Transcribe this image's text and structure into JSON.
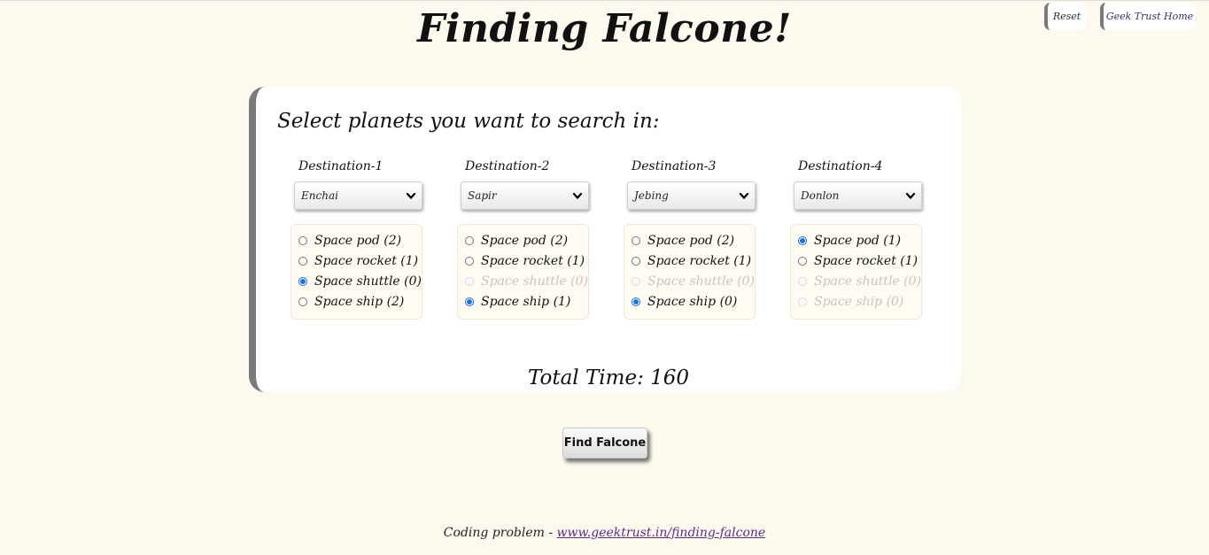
{
  "header": {
    "title": "Finding Falcone!",
    "reset_label": "Reset",
    "home_label": "Geek Trust Home"
  },
  "card": {
    "heading": "Select planets you want to search in:",
    "total_time_label": "Total Time:",
    "total_time_value": "160"
  },
  "destinations": [
    {
      "label": "Destination-1",
      "planet": "Enchai",
      "vehicles": [
        {
          "label": "Space pod (2)",
          "checked": false,
          "disabled": false
        },
        {
          "label": "Space rocket (1)",
          "checked": false,
          "disabled": false
        },
        {
          "label": "Space shuttle (0)",
          "checked": true,
          "disabled": false
        },
        {
          "label": "Space ship (2)",
          "checked": false,
          "disabled": false
        }
      ]
    },
    {
      "label": "Destination-2",
      "planet": "Sapir",
      "vehicles": [
        {
          "label": "Space pod (2)",
          "checked": false,
          "disabled": false
        },
        {
          "label": "Space rocket (1)",
          "checked": false,
          "disabled": false
        },
        {
          "label": "Space shuttle (0)",
          "checked": false,
          "disabled": true
        },
        {
          "label": "Space ship (1)",
          "checked": true,
          "disabled": false
        }
      ]
    },
    {
      "label": "Destination-3",
      "planet": "Jebing",
      "vehicles": [
        {
          "label": "Space pod (2)",
          "checked": false,
          "disabled": false
        },
        {
          "label": "Space rocket (1)",
          "checked": false,
          "disabled": false
        },
        {
          "label": "Space shuttle (0)",
          "checked": false,
          "disabled": true
        },
        {
          "label": "Space ship (0)",
          "checked": true,
          "disabled": false
        }
      ]
    },
    {
      "label": "Destination-4",
      "planet": "Donlon",
      "vehicles": [
        {
          "label": "Space pod (1)",
          "checked": true,
          "disabled": false
        },
        {
          "label": "Space rocket (1)",
          "checked": false,
          "disabled": false
        },
        {
          "label": "Space shuttle (0)",
          "checked": false,
          "disabled": true
        },
        {
          "label": "Space ship (0)",
          "checked": false,
          "disabled": true
        }
      ]
    }
  ],
  "actions": {
    "find_label": "Find Falcone"
  },
  "footer": {
    "prefix": "Coding problem - ",
    "link_text": "www.geektrust.in/finding-falcone"
  },
  "colors": {
    "background": "#fef9ee",
    "card": "#ffffff",
    "accent_border": "#7a7a7a",
    "radio_checked": "#1a73e8",
    "link": "#5a2d8c"
  },
  "icons": {
    "select_arrow": "chevron-down-icon"
  }
}
